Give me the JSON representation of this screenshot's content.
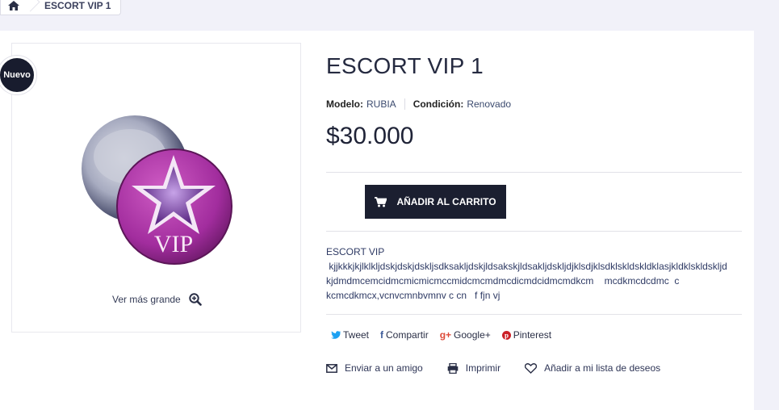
{
  "breadcrumb": {
    "current": "ESCORT VIP 1"
  },
  "product": {
    "badge": "Nuevo",
    "title": "ESCORT VIP 1",
    "model_label": "Modelo:",
    "model_value": "RUBIA",
    "condition_label": "Condición:",
    "condition_value": "Renovado",
    "price": "$30.000",
    "view_larger": "Ver más grande",
    "image_text": "VIP"
  },
  "cart": {
    "label": "AÑADIR AL CARRITO"
  },
  "description": {
    "lines": [
      "ESCORT VIP",
      " kjjkkkjkjlklkljdskjdskjdskljsdksakljdskjldsakskjldsakljdskljdjklsdjklsdklskldskldklasjkldklskldskljd",
      "kjdmdmcemcidmcmicmicmccmidcmcmdmcdicmdcidmcmdkcm    mcdkmcdcdmc  c",
      "kcmcdkmcx,vcnvcmnbvmnv c cn   f fjn vj"
    ]
  },
  "social": {
    "tweet": "Tweet",
    "share": "Compartir",
    "google": "Google+",
    "pinterest": "Pinterest",
    "colors": {
      "twitter": "#1da1f2",
      "facebook": "#3b5998",
      "google": "#dd4b39",
      "pinterest": "#cb2027"
    }
  },
  "actions": {
    "send_friend": "Enviar a un amigo",
    "print": "Imprimir",
    "wishlist": "Añadir a mi lista de deseos"
  },
  "icons": [
    "home-icon",
    "zoom-in-icon",
    "cart-icon",
    "twitter-icon",
    "facebook-icon",
    "google-plus-icon",
    "pinterest-icon",
    "envelope-icon",
    "print-icon",
    "heart-icon"
  ]
}
